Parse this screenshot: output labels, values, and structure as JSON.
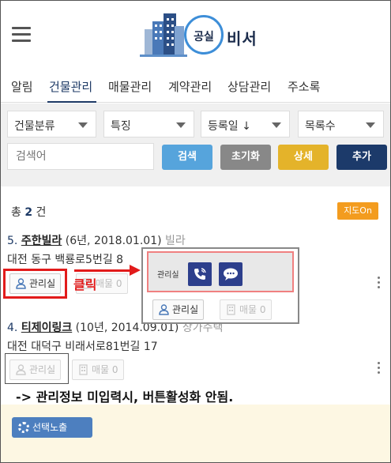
{
  "header": {
    "logo_circle_text": "공실",
    "logo_text": "비서"
  },
  "tabs": [
    {
      "label": "알림"
    },
    {
      "label": "건물관리",
      "active": true
    },
    {
      "label": "매물관리"
    },
    {
      "label": "계약관리"
    },
    {
      "label": "상담관리"
    },
    {
      "label": "주소록"
    }
  ],
  "filters": {
    "selects": [
      "건물분류",
      "특징",
      "등록일 ↓",
      "목록수"
    ],
    "search_placeholder": "검색어",
    "buttons": {
      "search": "검색",
      "reset": "초기화",
      "detail": "상세",
      "add": "추가"
    }
  },
  "list": {
    "total_prefix": "총",
    "total_count": "2",
    "total_suffix": "건",
    "map_label": "지도On",
    "items": [
      {
        "no": "5.",
        "name": "주한빌라",
        "meta": "(6년, 2018.01.01)",
        "type": "빌라",
        "address": "대전 동구 백룡로5번길 8",
        "manager_label": "관리실",
        "listing_label": "매물 0"
      },
      {
        "no": "4.",
        "name": "티제이링크",
        "meta": "(10년, 2014.09.01)",
        "type": "상가주택",
        "address": "대전 대덕구 비래서로81번길 17",
        "manager_label": "관리실",
        "listing_label": "매물 0"
      }
    ]
  },
  "annotation": {
    "click_label": "클릭",
    "popup_label": "관리실",
    "popup_manager_label": "관리실",
    "popup_listing_label": "매물 0",
    "note": "-> 관리정보 미입력시, 버튼활성화 안됨."
  },
  "bottom": {
    "expose_label": "선택노출"
  },
  "colors": {
    "brand_navy": "#1e3a66",
    "btn_search": "#56a4dc",
    "btn_reset": "#888888",
    "btn_detail": "#e4b32a",
    "btn_add": "#1c3a6a",
    "map_on": "#f39c1f",
    "annotation_red": "#e21b1b",
    "phone_button": "#2d3f8c"
  }
}
